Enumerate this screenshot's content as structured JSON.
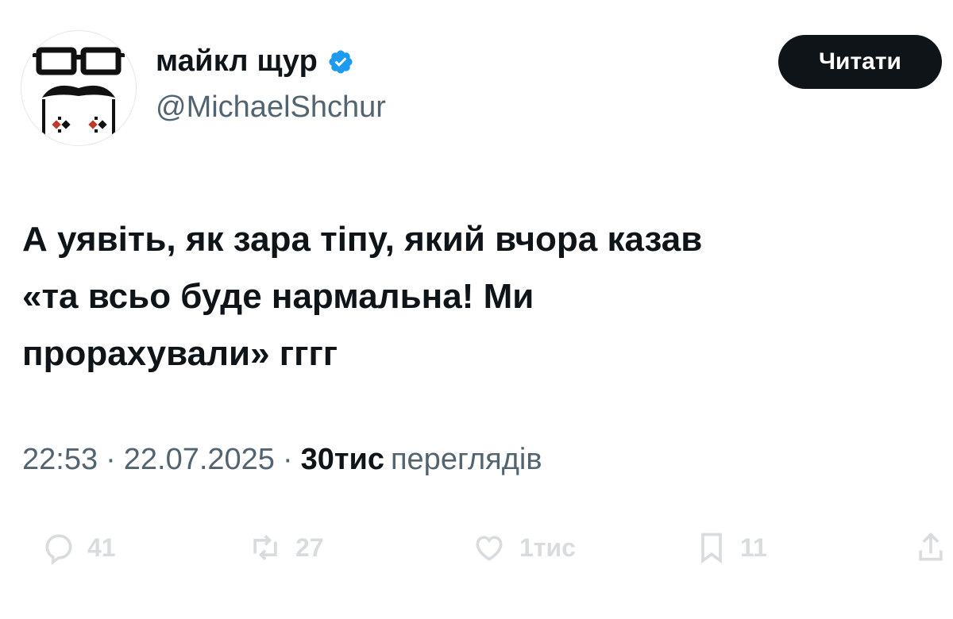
{
  "tweet": {
    "author": {
      "display_name": "майкл щур",
      "handle": "@MichaelShchur",
      "verified": true
    },
    "follow_button_label": "Читати",
    "text": "А уявіть, як зара тіпу, який вчора казав\n«та всьо буде нармальна! Ми\nпрорахували» гггг",
    "time": "22:53",
    "date": "22.07.2025",
    "separator": "·",
    "views_count": "30тис",
    "views_label": "переглядів",
    "actions": {
      "replies": "41",
      "reposts": "27",
      "likes": "1тис",
      "bookmarks": "11"
    }
  },
  "colors": {
    "text": "#0f1419",
    "secondary": "#536471",
    "verified_badge": "#1d9bf0",
    "button_bg": "#0f1419"
  }
}
